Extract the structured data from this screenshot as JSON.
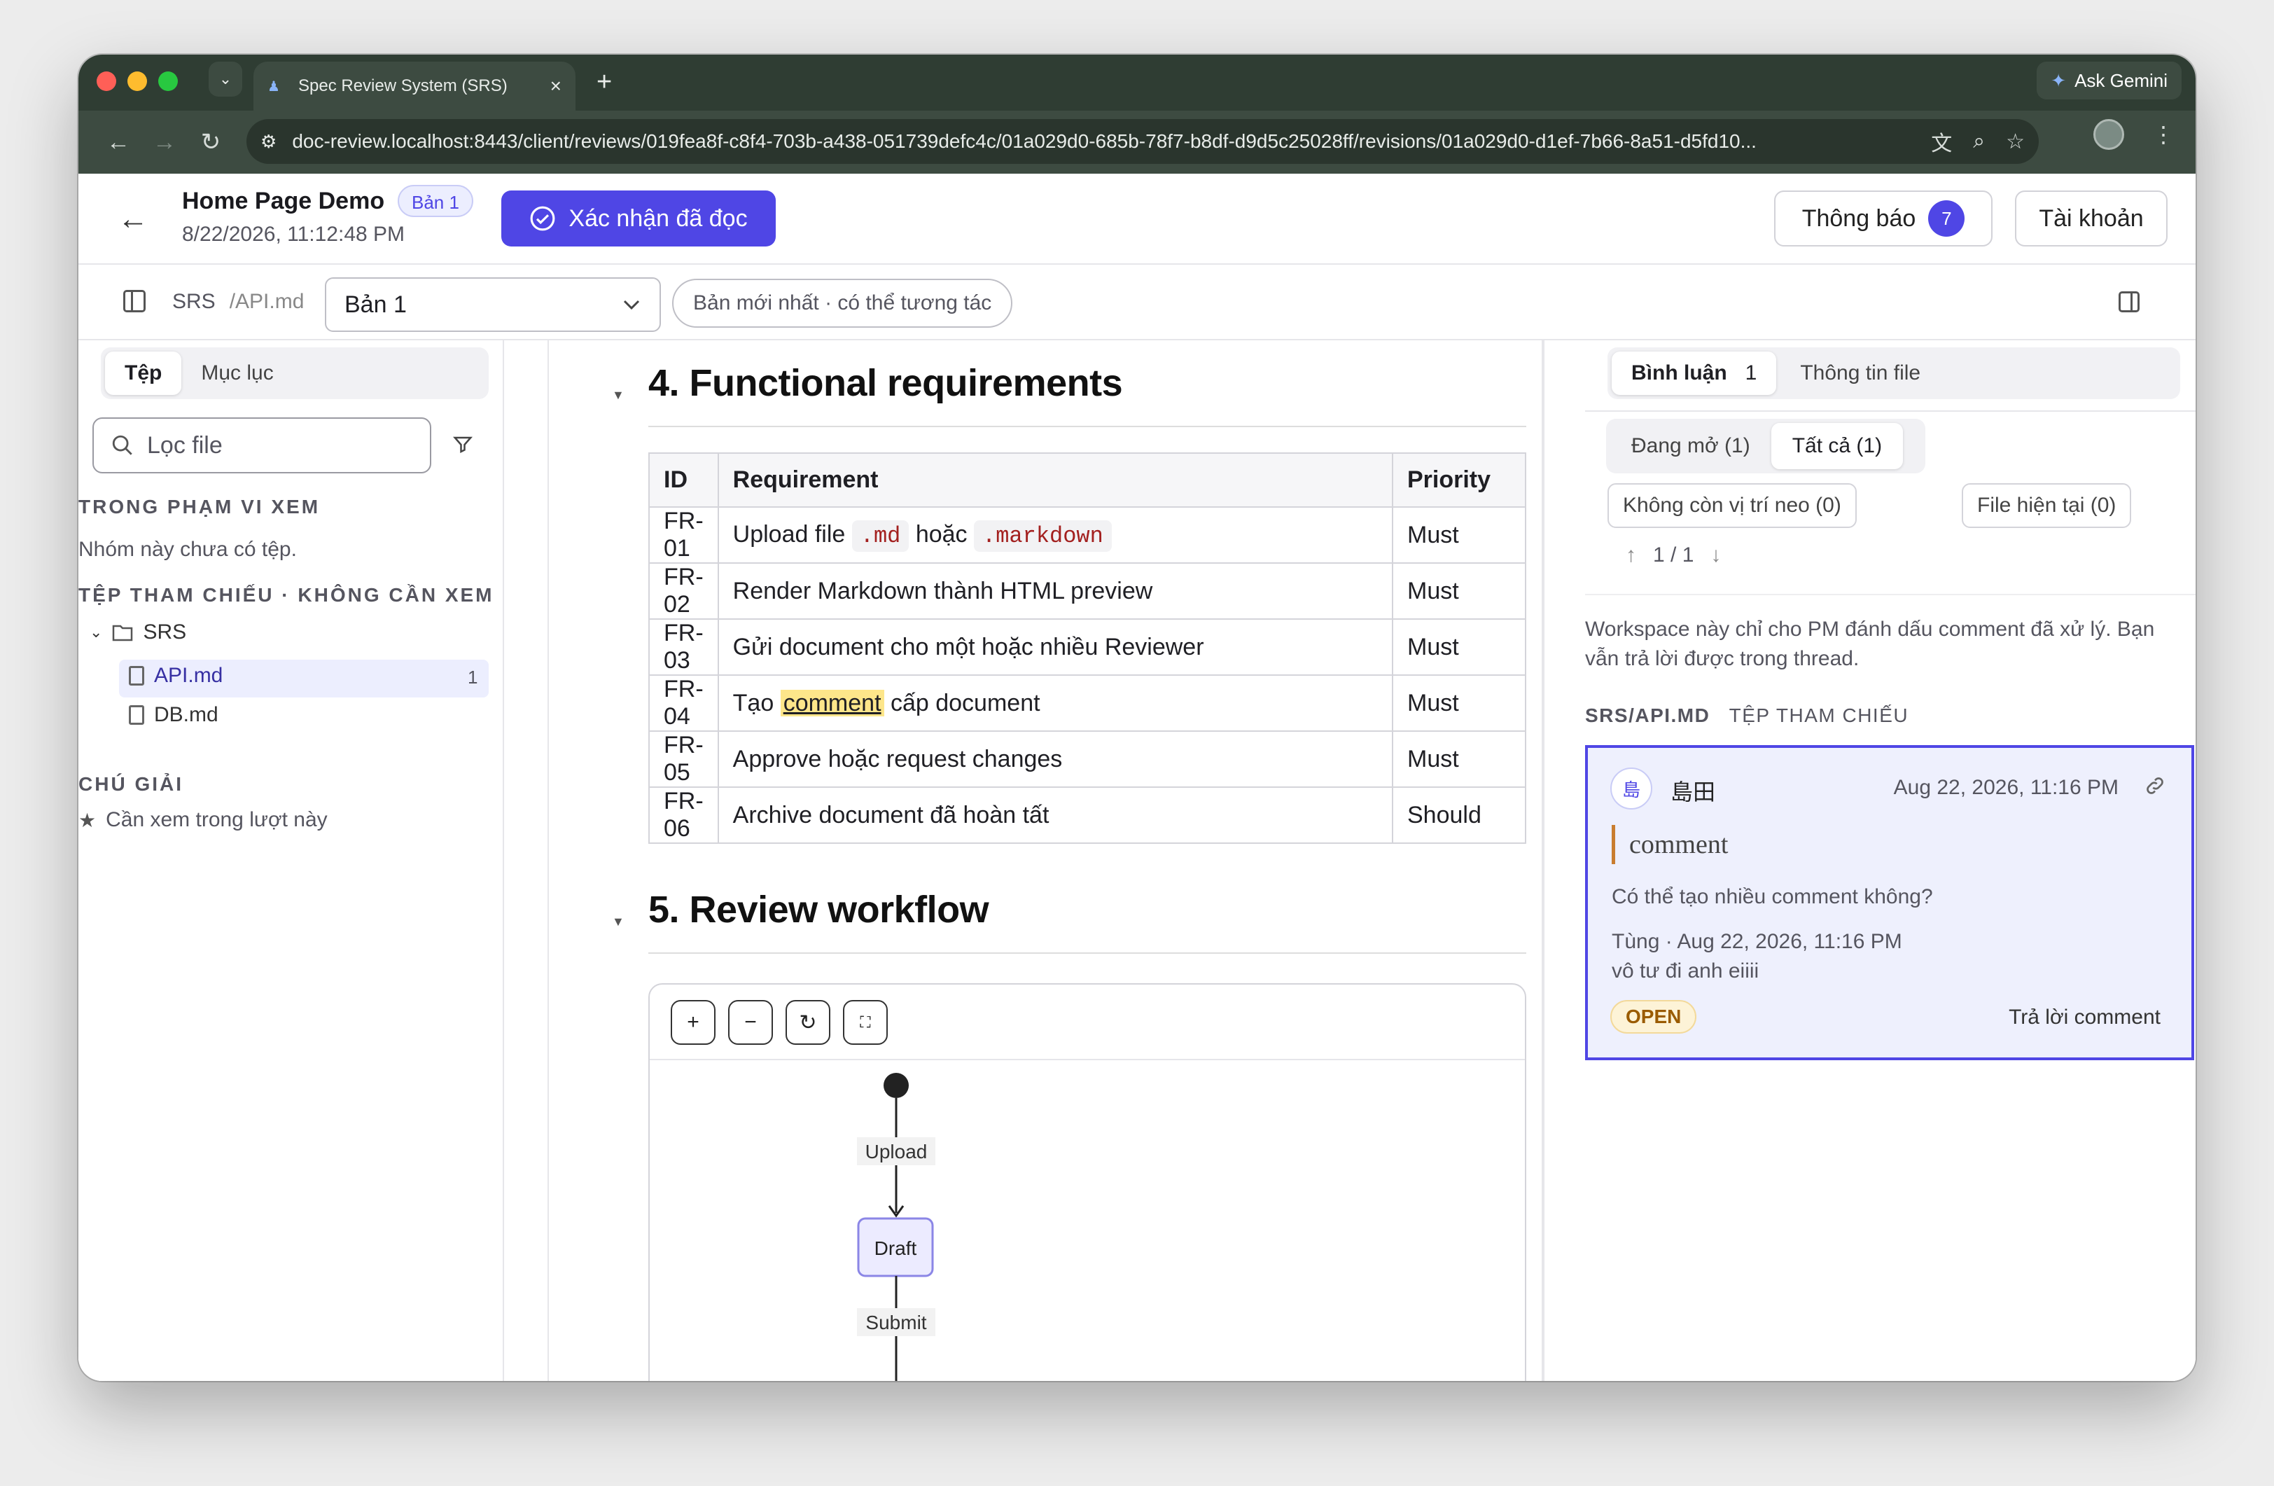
{
  "browser": {
    "tab_title": "Spec Review System (SRS)",
    "new_tab": "+",
    "ask_gemini": "Ask Gemini",
    "url": "doc-review.localhost:8443/client/reviews/019fea8f-c8f4-703b-a438-051739defc4c/01a029d0-685b-78f7-b8df-d9d5c25028ff/revisions/01a029d0-d1ef-7b66-8a51-d5fd10..."
  },
  "header": {
    "title": "Home Page Demo",
    "version_badge": "Bản 1",
    "date": "8/22/2026, 11:12:48 PM",
    "confirm_label": "Xác nhận đã đọc",
    "notif_label": "Thông báo",
    "notif_count": "7",
    "account_label": "Tài khoản"
  },
  "subbar": {
    "crumb_root": "SRS",
    "crumb_file": "/API.md",
    "version_select": "Bản 1",
    "status_pill": "Bản mới nhất · có thể tương tác"
  },
  "left": {
    "tab_files": "Tệp",
    "tab_toc": "Mục lục",
    "search_placeholder": "Lọc file",
    "section_in_scope": "TRONG PHẠM VI XEM",
    "in_scope_empty": "Nhóm này chưa có tệp.",
    "section_reference": "TỆP THAM CHIẾU · KHÔNG CẦN XEM",
    "folder": "SRS",
    "files": [
      {
        "name": "API.md",
        "count": "1"
      },
      {
        "name": "DB.md",
        "count": ""
      }
    ],
    "section_legend": "CHÚ GIẢI",
    "legend_item": "Cần xem trong lượt này"
  },
  "doc": {
    "h_functional": "4. Functional requirements",
    "table_headers": [
      "ID",
      "Requirement",
      "Priority"
    ],
    "rows": [
      {
        "id": "FR-01",
        "req_a": "Upload file ",
        "code1": ".md",
        "req_b": " hoặc ",
        "code2": ".markdown",
        "priority": "Must"
      },
      {
        "id": "FR-02",
        "req": "Render Markdown thành HTML preview",
        "priority": "Must"
      },
      {
        "id": "FR-03",
        "req": "Gửi document cho một hoặc nhiều Reviewer",
        "priority": "Must"
      },
      {
        "id": "FR-04",
        "req_a": "Tạo ",
        "highlight": "comment",
        "req_b": " cấp document",
        "priority": "Must"
      },
      {
        "id": "FR-05",
        "req": "Approve hoặc request changes",
        "priority": "Must"
      },
      {
        "id": "FR-06",
        "req": "Archive document đã hoàn tất",
        "priority": "Should"
      }
    ],
    "h_workflow": "5. Review workflow",
    "diagram": {
      "tools": [
        "+",
        "−",
        "↻",
        "⛶"
      ],
      "edge1": "Upload",
      "node1": "Draft",
      "edge2": "Submit"
    }
  },
  "right": {
    "tab_comments": "Bình luận",
    "tab_comments_count": "1",
    "tab_fileinfo": "Thông tin file",
    "filter_open": "Đang mở (1)",
    "filter_all": "Tất cả (1)",
    "chip_unanchored": "Không còn vị trí neo (0)",
    "chip_current": "File hiện tại (0)",
    "pager": "1 / 1",
    "note": "Workspace này chỉ cho PM đánh dấu comment đã xử lý. Bạn vẫn trả lời được trong thread.",
    "path": "SRS/API.MD",
    "path_tag": "TỆP THAM CHIẾU",
    "comment": {
      "avatar": "島",
      "author": "島田",
      "time": "Aug 22, 2026, 11:16 PM",
      "quote": "comment",
      "text": "Có thể tạo nhiều comment không?",
      "reply_meta": "Tùng · Aug 22, 2026, 11:16 PM",
      "reply_text": "vô tư đi anh eiiii",
      "status": "OPEN",
      "reply_action": "Trả lời comment"
    }
  },
  "colors": {
    "accent": "#4f46e5",
    "browser_frame": "#3d4b41",
    "open_badge": "#9a5b00"
  }
}
